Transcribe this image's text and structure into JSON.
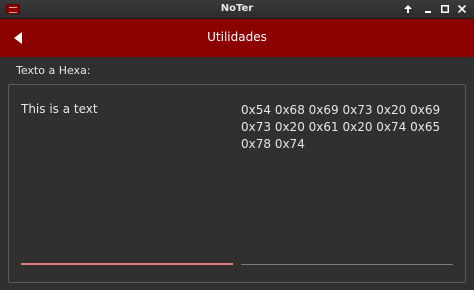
{
  "window": {
    "title": "NoTer",
    "app_icon": "app-logo-icon",
    "controls": [
      "arrow-up-icon",
      "minimize-icon",
      "maximize-icon",
      "close-icon"
    ]
  },
  "appbar": {
    "title": "Utilidades",
    "back_icon": "back-arrow-icon",
    "color": "#8b0000"
  },
  "converter": {
    "label": "Texto a Hexa:",
    "input_value": "This is a text",
    "output_value": "0x54 0x68 0x69 0x73 0x20 0x69 0x73 0x20 0x61 0x20 0x74 0x65 0x78 0x74",
    "focus_color": "#e07e7e"
  }
}
